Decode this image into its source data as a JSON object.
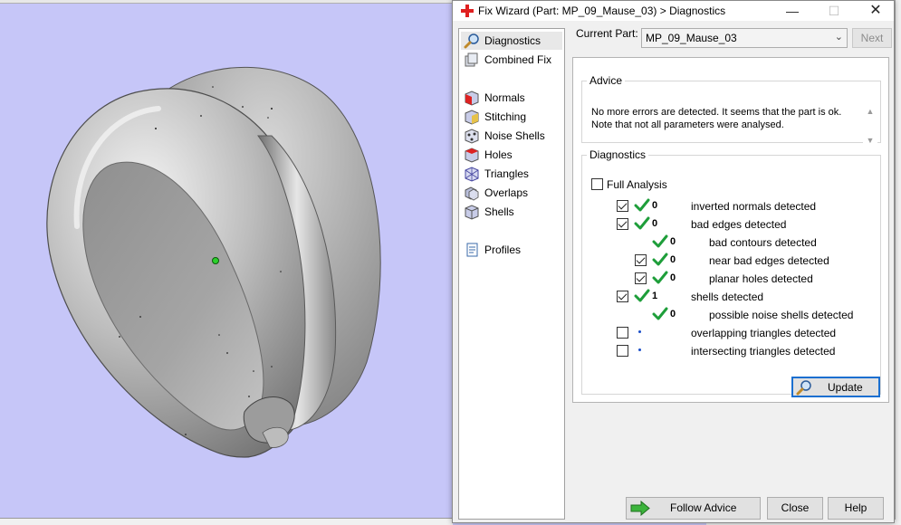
{
  "dialog": {
    "title": "Fix Wizard (Part: MP_09_Mause_03) > Diagnostics",
    "window_controls": {
      "minimize": "—",
      "maximize": "☐",
      "close": "✕"
    }
  },
  "nav": {
    "items": [
      {
        "label": "Diagnostics",
        "icon": "magnifier-icon",
        "selected": true
      },
      {
        "label": "Combined Fix",
        "icon": "combined-fix-icon"
      },
      {
        "label": "Normals",
        "icon": "normals-icon"
      },
      {
        "label": "Stitching",
        "icon": "stitching-icon"
      },
      {
        "label": "Noise Shells",
        "icon": "noise-shells-icon"
      },
      {
        "label": "Holes",
        "icon": "holes-icon"
      },
      {
        "label": "Triangles",
        "icon": "triangles-icon"
      },
      {
        "label": "Overlaps",
        "icon": "overlaps-icon"
      },
      {
        "label": "Shells",
        "icon": "shells-icon"
      },
      {
        "label": "Profiles",
        "icon": "profiles-icon"
      }
    ]
  },
  "part": {
    "label": "Current Part:",
    "selected": "MP_09_Mause_03",
    "next_label": "Next"
  },
  "advice": {
    "title": "Advice",
    "line1": "No more errors are detected. It seems that the part is ok.",
    "line2": "Note that not all parameters were analysed."
  },
  "diagnostics": {
    "title": "Diagnostics",
    "full_analysis_label": "Full Analysis",
    "full_analysis_checked": false,
    "rows": [
      {
        "checkbox": true,
        "checked": true,
        "status": "ok",
        "count": "0",
        "label": "inverted normals detected",
        "indent": 0
      },
      {
        "checkbox": true,
        "checked": true,
        "status": "ok",
        "count": "0",
        "label": "bad edges detected",
        "indent": 0
      },
      {
        "checkbox": false,
        "checked": false,
        "status": "ok",
        "count": "0",
        "label": "bad contours detected",
        "indent": 1
      },
      {
        "checkbox": true,
        "checked": true,
        "status": "ok",
        "count": "0",
        "label": "near bad edges detected",
        "indent": 1
      },
      {
        "checkbox": true,
        "checked": true,
        "status": "ok",
        "count": "0",
        "label": "planar holes detected",
        "indent": 1
      },
      {
        "checkbox": true,
        "checked": true,
        "status": "ok",
        "count": "1",
        "label": "shells detected",
        "indent": 0
      },
      {
        "checkbox": false,
        "checked": false,
        "status": "ok",
        "count": "0",
        "label": "possible noise shells detected",
        "indent": 1
      },
      {
        "checkbox": true,
        "checked": false,
        "status": "pending",
        "count": "",
        "label": "overlapping triangles detected",
        "indent": 0
      },
      {
        "checkbox": true,
        "checked": false,
        "status": "pending",
        "count": "",
        "label": "intersecting triangles detected",
        "indent": 0
      }
    ],
    "update_label": "Update"
  },
  "footer": {
    "follow_advice_label": "Follow Advice",
    "close_label": "Close",
    "help_label": "Help"
  },
  "colors": {
    "viewport_bg": "#c6c6f8",
    "check_green": "#1e9e3a",
    "focus_blue": "#1a6fd0",
    "model_gray": "#a8a8a8"
  }
}
